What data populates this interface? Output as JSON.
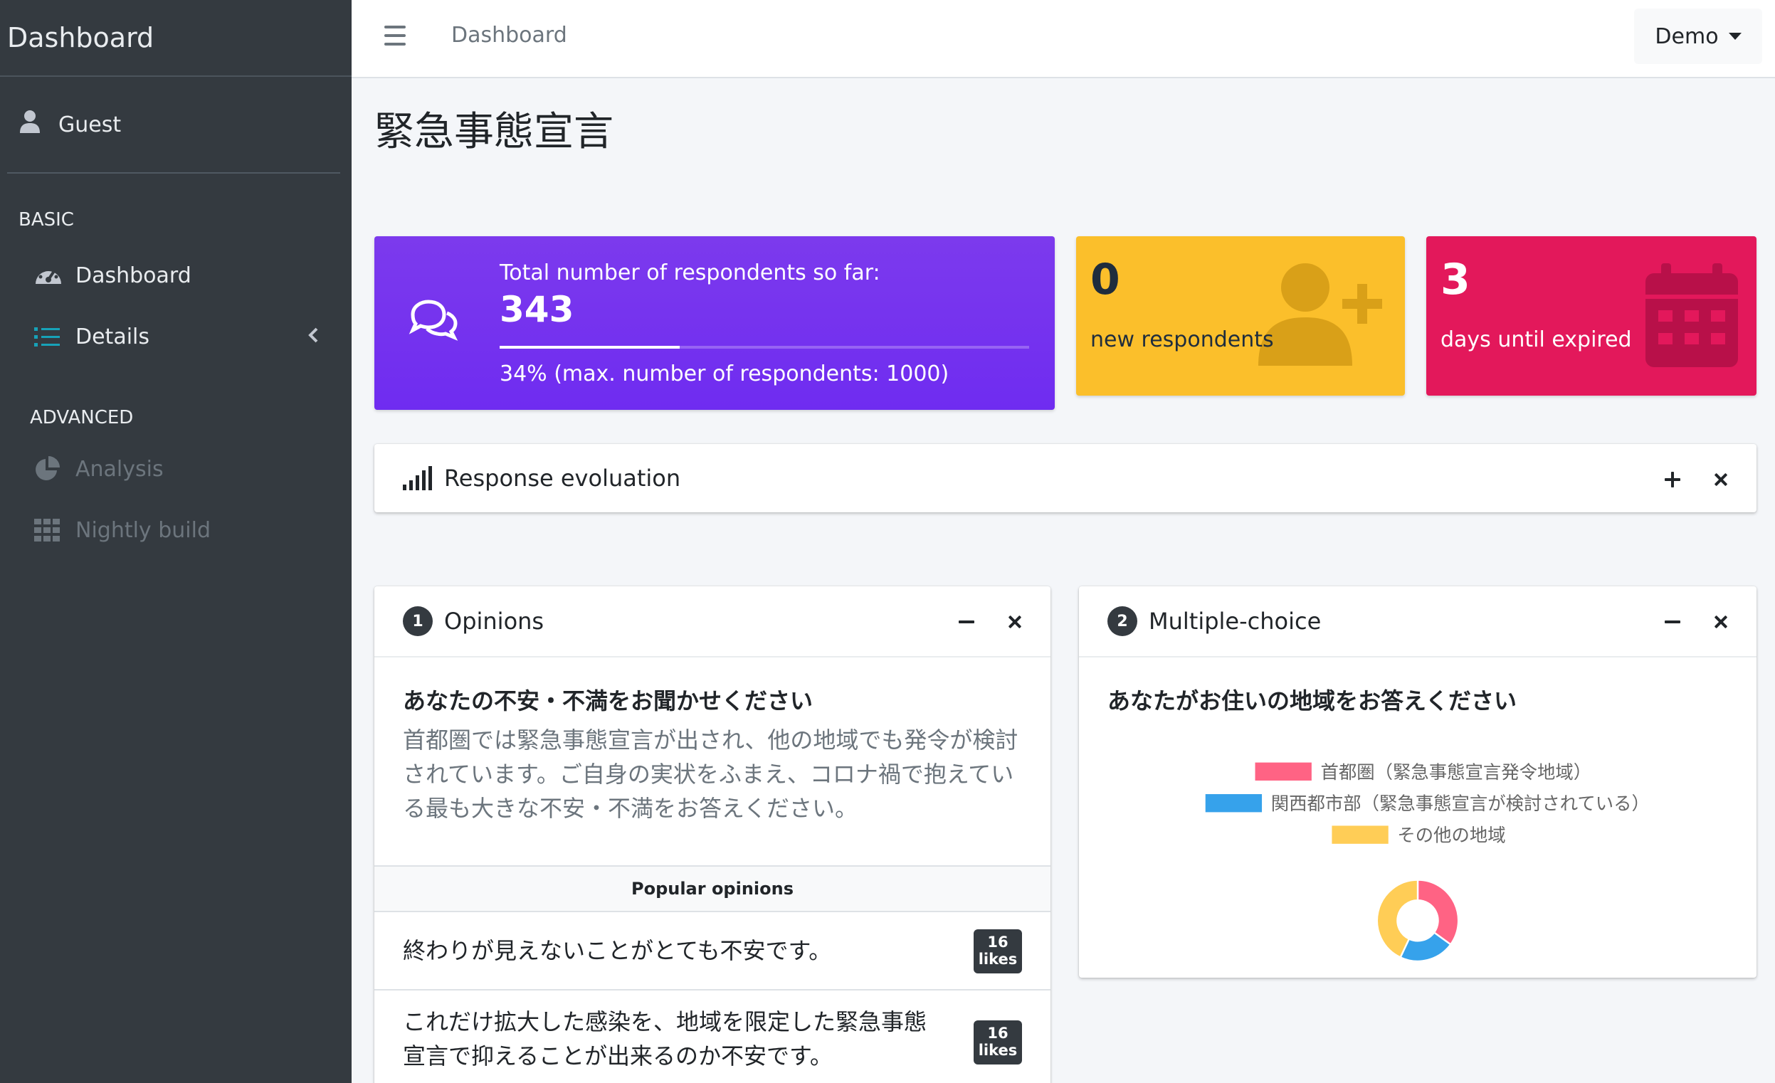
{
  "sidebar": {
    "brand": "Dashboard",
    "user": "Guest",
    "sections": [
      {
        "header": "BASIC"
      },
      {
        "header": "ADVANCED"
      }
    ],
    "items": [
      {
        "label": "Dashboard",
        "icon": "tachometer-icon"
      },
      {
        "label": "Details",
        "icon": "list-icon"
      },
      {
        "label": "Analysis",
        "icon": "pie-chart-icon"
      },
      {
        "label": "Nightly build",
        "icon": "grid-icon"
      }
    ]
  },
  "topbar": {
    "link": "Dashboard",
    "user_menu": "Demo"
  },
  "page": {
    "title": "緊急事態宣言"
  },
  "stats": {
    "respondents_label": "Total number of respondents so far:",
    "respondents_value": "343",
    "progress_fraction": 0.34,
    "progress_text": "34% (max. number of respondents: 1000)",
    "new_value": "0",
    "new_label": "new respondents",
    "days_value": "3",
    "days_label": "days until expired"
  },
  "colors": {
    "purple": "#7c3aed",
    "yellow": "#fbbf2b",
    "red": "#e3185b",
    "sidebar": "#343a40",
    "accent_blue": "#17a2b8"
  },
  "evolution": {
    "title": "Response evoluation"
  },
  "opinions": {
    "number": "1",
    "title": "Opinions",
    "question_title": "あなたの不安・不満をお聞かせください",
    "question_text": "首都圏では緊急事態宣言が出され、他の地域でも発令が検討されています。ご自身の実状をふまえ、コロナ禍で抱えている最も大きな不安・不満をお答えください。",
    "popular_header": "Popular opinions",
    "items": [
      {
        "text": "終わりが見えないことがとても不安です。",
        "likes_count": "16",
        "likes_label": "likes"
      },
      {
        "text": "これだけ拡大した感染を、地域を限定した緊急事態宣言で抑えることが出来るのか不安です。",
        "likes_count": "16",
        "likes_label": "likes"
      }
    ]
  },
  "multiple_choice": {
    "number": "2",
    "title": "Multiple-choice",
    "question_title": "あなたがお住いの地域をお答えください"
  },
  "chart_data": {
    "type": "pie",
    "variant": "doughnut",
    "title": "",
    "legend_position": "top",
    "categories": [
      "首都圏（緊急事態宣言発令地域）",
      "関西都市部（緊急事態宣言が検討されている）",
      "その他の地域"
    ],
    "values": [
      35,
      22,
      43
    ],
    "colors": [
      "#ff6384",
      "#36a2eb",
      "#ffcd56"
    ]
  }
}
